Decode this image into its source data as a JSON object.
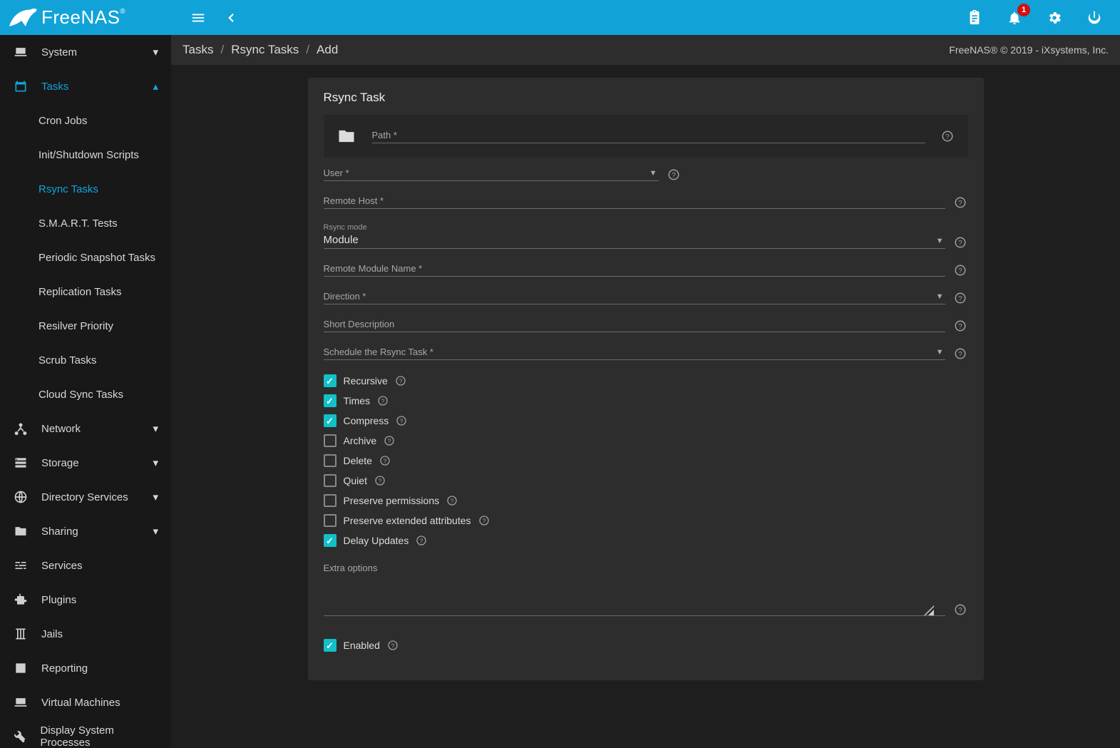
{
  "brand": "FreeNAS",
  "notifications": {
    "count": "1"
  },
  "breadcrumb": {
    "a": "Tasks",
    "b": "Rsync Tasks",
    "c": "Add"
  },
  "footer_right": "FreeNAS® © 2019 - iXsystems, Inc.",
  "sidebar": {
    "system": "System",
    "tasks": "Tasks",
    "tasks_children": {
      "cron": "Cron Jobs",
      "init": "Init/Shutdown Scripts",
      "rsync": "Rsync Tasks",
      "smart": "S.M.A.R.T. Tests",
      "snapshot": "Periodic Snapshot Tasks",
      "replication": "Replication Tasks",
      "resilver": "Resilver Priority",
      "scrub": "Scrub Tasks",
      "cloud": "Cloud Sync Tasks"
    },
    "network": "Network",
    "storage": "Storage",
    "dirsvc": "Directory Services",
    "sharing": "Sharing",
    "services": "Services",
    "plugins": "Plugins",
    "jails": "Jails",
    "reporting": "Reporting",
    "vm": "Virtual Machines",
    "dispproc": "Display System Processes"
  },
  "card": {
    "title": "Rsync Task",
    "path_label": "Path *",
    "user_label": "User *",
    "remote_host_label": "Remote Host *",
    "rsync_mode_small": "Rsync mode",
    "rsync_mode_value": "Module",
    "remote_module_label": "Remote Module Name *",
    "direction_label": "Direction *",
    "short_desc_label": "Short Description",
    "schedule_label": "Schedule the Rsync Task *",
    "checks": {
      "recursive": "Recursive",
      "times": "Times",
      "compress": "Compress",
      "archive": "Archive",
      "delete": "Delete",
      "quiet": "Quiet",
      "perms": "Preserve permissions",
      "xattr": "Preserve extended attributes",
      "delay": "Delay Updates"
    },
    "extra_label": "Extra options",
    "enabled": "Enabled"
  }
}
